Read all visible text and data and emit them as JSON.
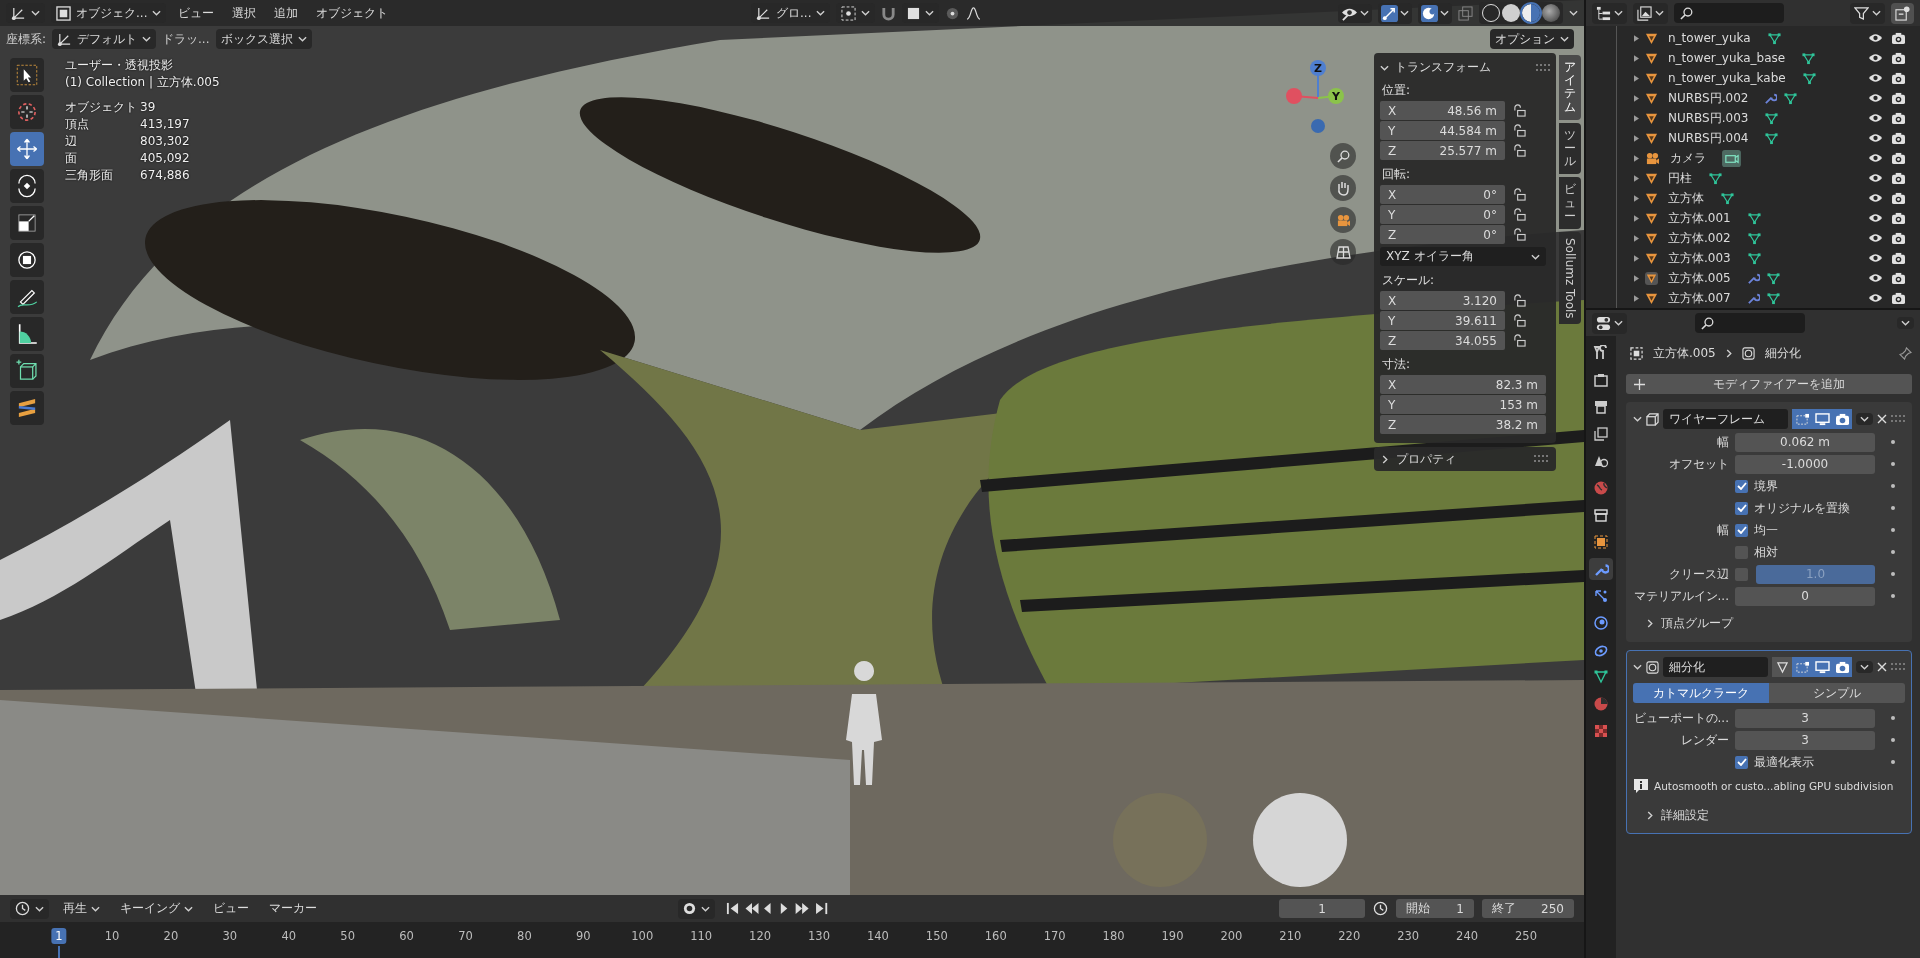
{
  "header": {
    "mode": "オブジェク...",
    "menus": [
      "ビュー",
      "選択",
      "追加",
      "オブジェクト"
    ],
    "orientation": "グロ..."
  },
  "tool_settings": {
    "orientation_label": "座標系:",
    "orientation": "デフォルト",
    "drag_label": "ドラッ...",
    "drag": "ボックス選択",
    "options": "オプション"
  },
  "shading_modes": [
    {
      "kind": "wire",
      "selected": false
    },
    {
      "kind": "solid",
      "selected": false
    },
    {
      "kind": "material",
      "selected": true
    },
    {
      "kind": "rendered",
      "selected": false
    }
  ],
  "tools": [
    {
      "kind": "select",
      "selected": false
    },
    {
      "kind": "cursor",
      "selected": false
    },
    {
      "kind": "move",
      "selected": true
    },
    {
      "kind": "rotate",
      "selected": false
    },
    {
      "kind": "scale",
      "selected": false
    },
    {
      "kind": "transform",
      "selected": false
    },
    {
      "kind": "annotate",
      "selected": false
    },
    {
      "kind": "measure",
      "selected": false
    },
    {
      "kind": "add-cube",
      "selected": false
    },
    {
      "kind": "sollumz",
      "selected": false
    }
  ],
  "overlay": {
    "view": "ユーザー・透視投影",
    "context": "(1) Collection | 立方体.005",
    "stats": [
      {
        "label": "オブジェクト",
        "value": "39"
      },
      {
        "label": "頂点",
        "value": "413,197"
      },
      {
        "label": "辺",
        "value": "803,302"
      },
      {
        "label": "面",
        "value": "405,092"
      },
      {
        "label": "三角形面",
        "value": "674,886"
      }
    ]
  },
  "gizmo": [
    "Z",
    "Y"
  ],
  "n_panel": {
    "title": "トランスフォーム",
    "sections": [
      {
        "label": "位置:",
        "locks": true,
        "fields": [
          {
            "axis": "X",
            "value": "48.56 m"
          },
          {
            "axis": "Y",
            "value": "44.584 m"
          },
          {
            "axis": "Z",
            "value": "25.577 m"
          }
        ]
      },
      {
        "label": "回転:",
        "locks": true,
        "fields": [
          {
            "axis": "X",
            "value": "0°"
          },
          {
            "axis": "Y",
            "value": "0°"
          },
          {
            "axis": "Z",
            "value": "0°"
          }
        ],
        "mode": "XYZ オイラー角"
      },
      {
        "label": "スケール:",
        "locks": true,
        "fields": [
          {
            "axis": "X",
            "value": "3.120"
          },
          {
            "axis": "Y",
            "value": "39.611"
          },
          {
            "axis": "Z",
            "value": "34.055"
          }
        ]
      },
      {
        "label": "寸法:",
        "locks": false,
        "fields": [
          {
            "axis": "X",
            "value": "82.3 m"
          },
          {
            "axis": "Y",
            "value": "153 m"
          },
          {
            "axis": "Z",
            "value": "38.2 m"
          }
        ]
      }
    ],
    "collapsed_panel": "プロパティ"
  },
  "n_tabs": [
    {
      "label": "アイテム",
      "selected": true,
      "kind": "stacked"
    },
    {
      "label": "ツール",
      "selected": false,
      "kind": "stacked"
    },
    {
      "label": "ビュー",
      "selected": false,
      "kind": "stacked"
    },
    {
      "label": "Sollumz Tools",
      "selected": false,
      "kind": "rotated"
    }
  ],
  "outliner": {
    "items": [
      {
        "name": "n_tower_yuka",
        "kind": "mesh",
        "modifier": false,
        "selected": false
      },
      {
        "name": "n_tower_yuka_base",
        "kind": "mesh",
        "modifier": false,
        "selected": false
      },
      {
        "name": "n_tower_yuka_kabe",
        "kind": "mesh",
        "modifier": false,
        "selected": false
      },
      {
        "name": "NURBS円.002",
        "kind": "mesh",
        "modifier": true,
        "selected": false
      },
      {
        "name": "NURBS円.003",
        "kind": "mesh",
        "modifier": false,
        "selected": false
      },
      {
        "name": "NURBS円.004",
        "kind": "mesh",
        "modifier": false,
        "selected": false
      },
      {
        "name": "カメラ",
        "kind": "camera",
        "modifier": false,
        "selected": false
      },
      {
        "name": "円柱",
        "kind": "mesh",
        "modifier": false,
        "selected": false
      },
      {
        "name": "立方体",
        "kind": "mesh",
        "modifier": false,
        "selected": false
      },
      {
        "name": "立方体.001",
        "kind": "mesh",
        "modifier": false,
        "selected": false
      },
      {
        "name": "立方体.002",
        "kind": "mesh",
        "modifier": false,
        "selected": false
      },
      {
        "name": "立方体.003",
        "kind": "mesh",
        "modifier": false,
        "selected": false
      },
      {
        "name": "立方体.005",
        "kind": "mesh",
        "modifier": true,
        "selected": true
      },
      {
        "name": "立方体.007",
        "kind": "mesh",
        "modifier": true,
        "selected": false
      }
    ]
  },
  "properties": {
    "tabs": [
      {
        "kind": "tool",
        "selected": false
      },
      {
        "kind": "render",
        "selected": false
      },
      {
        "kind": "output",
        "selected": false
      },
      {
        "kind": "view-layer",
        "selected": false
      },
      {
        "kind": "scene",
        "selected": false
      },
      {
        "kind": "world",
        "selected": false
      },
      {
        "kind": "collection",
        "selected": false
      },
      {
        "kind": "object",
        "selected": false
      },
      {
        "kind": "modifier",
        "selected": true
      },
      {
        "kind": "particles",
        "selected": false
      },
      {
        "kind": "physics",
        "selected": false
      },
      {
        "kind": "constraints",
        "selected": false
      },
      {
        "kind": "data",
        "selected": false
      },
      {
        "kind": "material",
        "selected": false
      },
      {
        "kind": "texture",
        "selected": false
      }
    ],
    "breadcrumb": [
      "立方体.005",
      "細分化"
    ],
    "add_button": "モディファイアーを追加",
    "modifiers": [
      {
        "kind": "wireframe",
        "name": "ワイヤーフレーム",
        "active": false,
        "rows": [
          {
            "kind": "number",
            "label": "幅",
            "value": "0.062 m"
          },
          {
            "kind": "number",
            "label": "オフセット",
            "value": "-1.0000"
          },
          {
            "kind": "check",
            "label": "境界",
            "checked": true
          },
          {
            "kind": "check",
            "label": "オリジナルを置換",
            "checked": true
          },
          {
            "kind": "check",
            "prefix": "幅",
            "label": "均一",
            "checked": true
          },
          {
            "kind": "check",
            "label": "相対",
            "checked": false
          },
          {
            "kind": "check-number",
            "label": "クリース辺",
            "checked": false,
            "value": "1.0",
            "disabled": true
          },
          {
            "kind": "number",
            "label": "マテリアルイン...",
            "value": "0"
          },
          {
            "kind": "subpanel",
            "label": "頂点グループ",
            "expanded": false
          }
        ]
      },
      {
        "kind": "subdivision",
        "name": "細分化",
        "active": true,
        "rows": [
          {
            "kind": "toggle",
            "options": [
              {
                "label": "カトマルクラーク",
                "selected": true
              },
              {
                "label": "シンプル",
                "selected": false
              }
            ]
          },
          {
            "kind": "number",
            "label": "ビューポートの...",
            "value": "3"
          },
          {
            "kind": "number",
            "label": "レンダー",
            "value": "3"
          },
          {
            "kind": "check",
            "label": "最適化表示",
            "checked": true
          },
          {
            "kind": "info",
            "text": "Autosmooth or custo...abling GPU subdivision"
          },
          {
            "kind": "subpanel",
            "label": "詳細設定",
            "expanded": false
          }
        ]
      }
    ]
  },
  "timeline": {
    "menus": [
      {
        "label": "再生",
        "dropdown": true
      },
      {
        "label": "キーイング",
        "dropdown": true
      },
      {
        "label": "ビュー",
        "dropdown": false
      },
      {
        "label": "マーカー",
        "dropdown": false
      }
    ],
    "current_frame": "1",
    "start_label": "開始",
    "start": "1",
    "end_label": "終了",
    "end": "250",
    "ticks": [
      {
        "label": "1",
        "current": true
      },
      {
        "label": "10",
        "current": false
      },
      {
        "label": "20",
        "current": false
      },
      {
        "label": "30",
        "current": false
      },
      {
        "label": "40",
        "current": false
      },
      {
        "label": "50",
        "current": false
      },
      {
        "label": "60",
        "current": false
      },
      {
        "label": "70",
        "current": false
      },
      {
        "label": "80",
        "current": false
      },
      {
        "label": "90",
        "current": false
      },
      {
        "label": "100",
        "current": false
      },
      {
        "label": "110",
        "current": false
      },
      {
        "label": "120",
        "current": false
      },
      {
        "label": "130",
        "current": false
      },
      {
        "label": "140",
        "current": false
      },
      {
        "label": "150",
        "current": false
      },
      {
        "label": "160",
        "current": false
      },
      {
        "label": "170",
        "current": false
      },
      {
        "label": "180",
        "current": false
      },
      {
        "label": "190",
        "current": false
      },
      {
        "label": "200",
        "current": false
      },
      {
        "label": "210",
        "current": false
      },
      {
        "label": "220",
        "current": false
      },
      {
        "label": "230",
        "current": false
      },
      {
        "label": "240",
        "current": false
      },
      {
        "label": "250",
        "current": false
      }
    ]
  }
}
